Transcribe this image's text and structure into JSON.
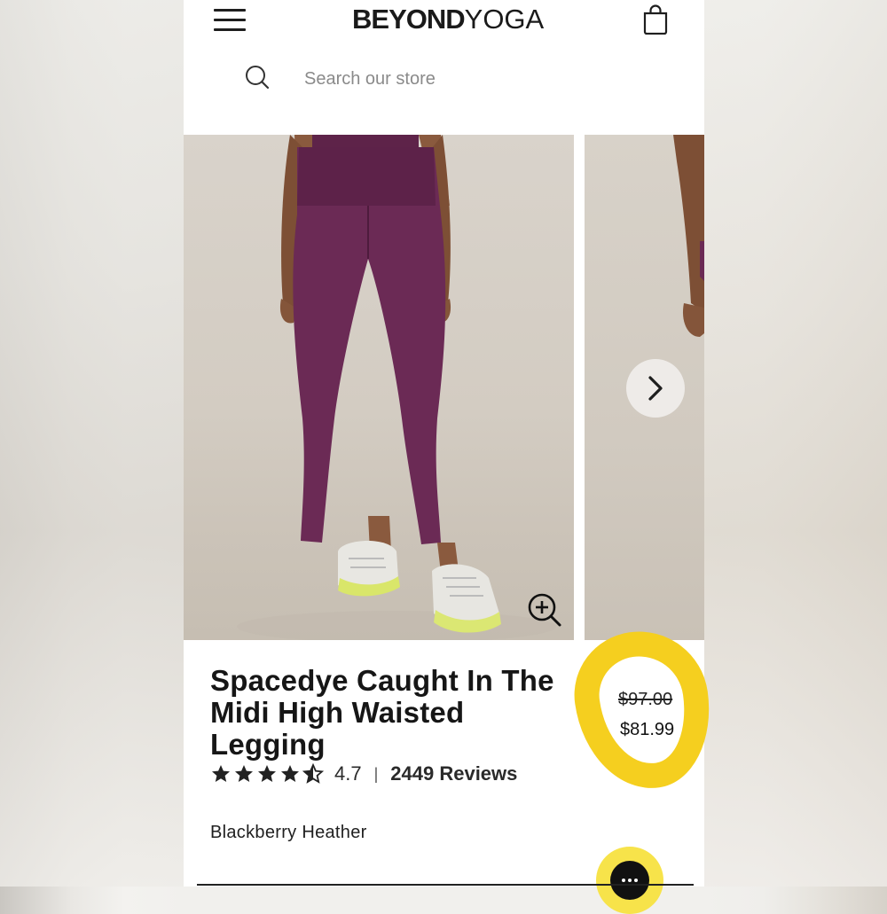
{
  "header": {
    "logo_bold": "BEYOND",
    "logo_light": "YOGA"
  },
  "search": {
    "placeholder": "Search our store"
  },
  "product": {
    "title": "Spacedye Caught In The Midi High Waisted Legging",
    "rating": "4.7",
    "rating_stars_value": 4.5,
    "separator": "|",
    "reviews_label": "2449 Reviews",
    "color": "Blackberry Heather",
    "price_original": "$97.00",
    "price_sale": "$81.99"
  },
  "colors": {
    "highlight": "#f5cf1f",
    "legging": "#6b2a55",
    "chat_button": "#f7e34a"
  },
  "icons": {
    "menu": "hamburger-icon",
    "cart": "shopping-bag-icon",
    "search": "search-icon",
    "zoom": "zoom-in-icon",
    "next": "chevron-right-icon",
    "chat": "chat-ellipsis-icon",
    "star": "star-icon"
  }
}
